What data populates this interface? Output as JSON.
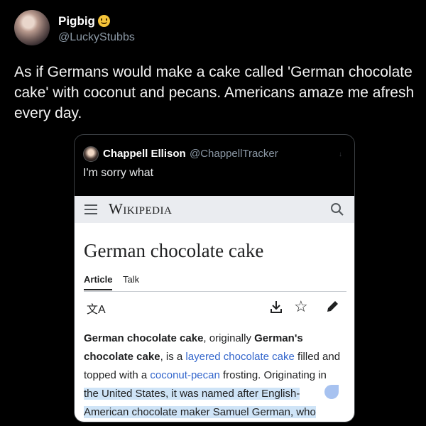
{
  "tweet": {
    "author_name": "Pigbig",
    "author_handle": "@LuckyStubbs",
    "text": "As if Germans would make a cake called 'German chocolate cake' with coconut and pecans. Americans amaze me afresh every day."
  },
  "quote": {
    "author_name": "Chappell Ellison",
    "author_handle": "@ChappellTracker",
    "text": "I'm sorry what",
    "more_label": "↓"
  },
  "wiki": {
    "logo": "Wikipedia",
    "title": "German chocolate cake",
    "tabs": [
      "Article",
      "Talk"
    ],
    "translate_glyph": "文A",
    "star_glyph": "☆",
    "body": {
      "b1": "German chocolate cake",
      "t1": ", originally ",
      "b2": "German's chocolate cake",
      "t2": ", is a ",
      "link1": "layered chocolate cake",
      "t3": " filled and topped with a ",
      "link2": "coconut-pecan",
      "t4": " frosting. Originating in ",
      "hl1": "the United States, it was named after English-",
      "hl2": "American chocolate maker Samuel German, who"
    }
  }
}
